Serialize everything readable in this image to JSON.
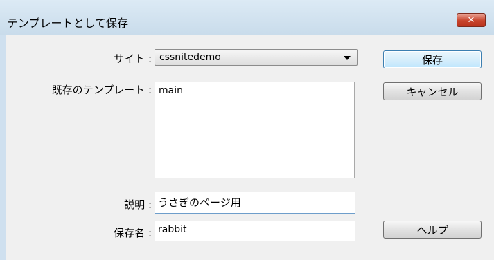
{
  "window": {
    "title": "テンプレートとして保存",
    "close_label": "✕"
  },
  "form": {
    "site_label": "サイト :",
    "site_value": "cssnitedemo",
    "templates_label": "既存のテンプレート :",
    "templates": [
      "main"
    ],
    "description_label": "説明 :",
    "description_value": "うさぎのページ用",
    "save_name_label": "保存名 :",
    "save_name_value": "rabbit"
  },
  "buttons": {
    "save": "保存",
    "cancel": "キャンセル",
    "help": "ヘルプ"
  }
}
